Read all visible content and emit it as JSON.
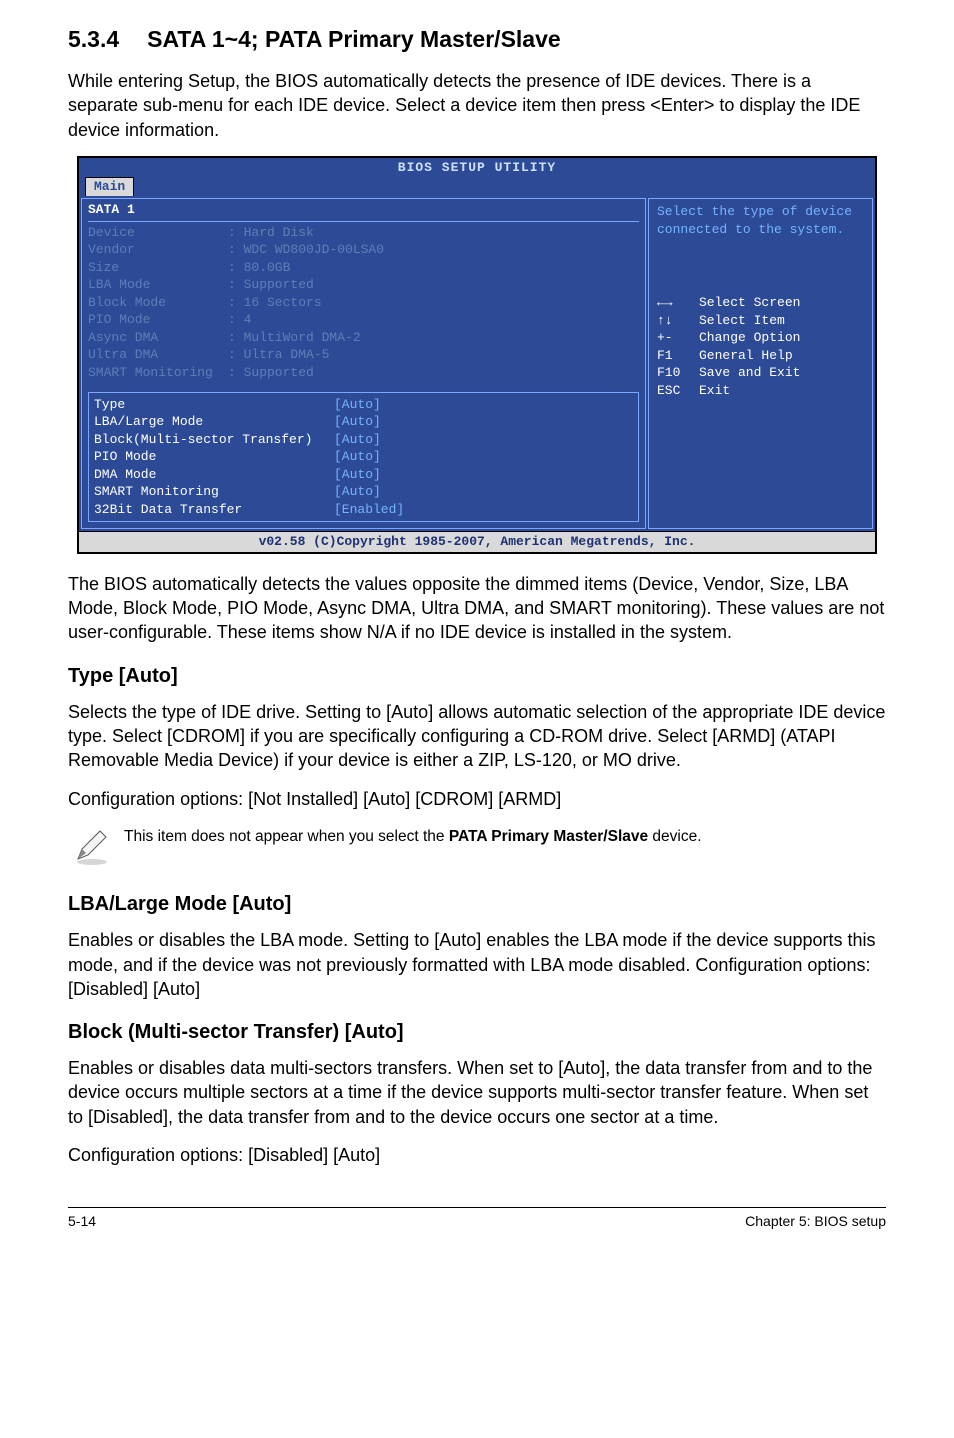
{
  "section": {
    "number": "5.3.4",
    "title": "SATA 1~4; PATA Primary Master/Slave",
    "intro": "While entering Setup, the BIOS automatically detects the presence of IDE devices. There is a separate sub-menu for each IDE device. Select a device item then press <Enter> to display the IDE device information."
  },
  "bios": {
    "titlebar": "BIOS SETUP UTILITY",
    "tab": "Main",
    "panel_title": "SATA 1",
    "info": [
      {
        "label": "Device",
        "value": ": Hard Disk"
      },
      {
        "label": "Vendor",
        "value": ": WDC WD800JD-00LSA0"
      },
      {
        "label": "Size",
        "value": ": 80.0GB"
      },
      {
        "label": "LBA Mode",
        "value": ": Supported"
      },
      {
        "label": "Block Mode",
        "value": ": 16 Sectors"
      },
      {
        "label": "PIO Mode",
        "value": ": 4"
      },
      {
        "label": "Async DMA",
        "value": ": MultiWord DMA-2"
      },
      {
        "label": "Ultra DMA",
        "value": ": Ultra DMA-5"
      },
      {
        "label": "SMART Monitoring",
        "value": ": Supported"
      }
    ],
    "config": [
      {
        "label": "Type",
        "value": "[Auto]"
      },
      {
        "label": "LBA/Large Mode",
        "value": "[Auto]"
      },
      {
        "label": "Block(Multi-sector Transfer)",
        "value": "[Auto]"
      },
      {
        "label": "PIO Mode",
        "value": "[Auto]"
      },
      {
        "label": "DMA Mode",
        "value": "[Auto]"
      },
      {
        "label": "SMART Monitoring",
        "value": "[Auto]"
      },
      {
        "label": "32Bit Data Transfer",
        "value": "[Enabled]"
      }
    ],
    "right_help_top": "Select the type of device connected to the system.",
    "help": [
      {
        "key": "←→",
        "text": "Select Screen"
      },
      {
        "key": "↑↓",
        "text": "Select Item"
      },
      {
        "key": "+-",
        "text": "Change Option"
      },
      {
        "key": "F1",
        "text": "General Help"
      },
      {
        "key": "F10",
        "text": "Save and Exit"
      },
      {
        "key": "ESC",
        "text": "Exit"
      }
    ],
    "copyright": "v02.58 (C)Copyright 1985-2007, American Megatrends, Inc."
  },
  "after_bios": "The BIOS automatically detects the values opposite the dimmed items (Device, Vendor, Size, LBA Mode, Block Mode, PIO Mode, Async DMA, Ultra DMA, and SMART monitoring). These values are not user-configurable. These items show N/A if no IDE device is installed in the system.",
  "type_section": {
    "heading": "Type [Auto]",
    "body": "Selects the type of IDE drive. Setting to [Auto] allows automatic selection of the appropriate IDE device type. Select [CDROM] if you are specifically configuring a CD-ROM drive. Select [ARMD] (ATAPI Removable Media Device) if your device is either a ZIP, LS-120, or MO drive.",
    "options": "Configuration options: [Not Installed] [Auto] [CDROM] [ARMD]"
  },
  "note": {
    "prefix": "This item does not appear when you select the ",
    "bold": "PATA Primary Master/Slave",
    "suffix": " device."
  },
  "lba_section": {
    "heading": "LBA/Large Mode [Auto]",
    "body": "Enables or disables the LBA mode. Setting to [Auto] enables the LBA mode if the device supports this mode, and if the device was not previously formatted with LBA mode disabled. Configuration options: [Disabled] [Auto]"
  },
  "block_section": {
    "heading": "Block (Multi-sector Transfer) [Auto]",
    "body": "Enables or disables data multi-sectors transfers. When set to [Auto], the data transfer from and to the device occurs multiple sectors at a time if the device supports multi-sector transfer feature. When set to [Disabled], the data transfer from and to the device occurs one sector at a time.",
    "options": "Configuration options: [Disabled] [Auto]"
  },
  "footer": {
    "left": "5-14",
    "right": "Chapter 5: BIOS setup"
  }
}
